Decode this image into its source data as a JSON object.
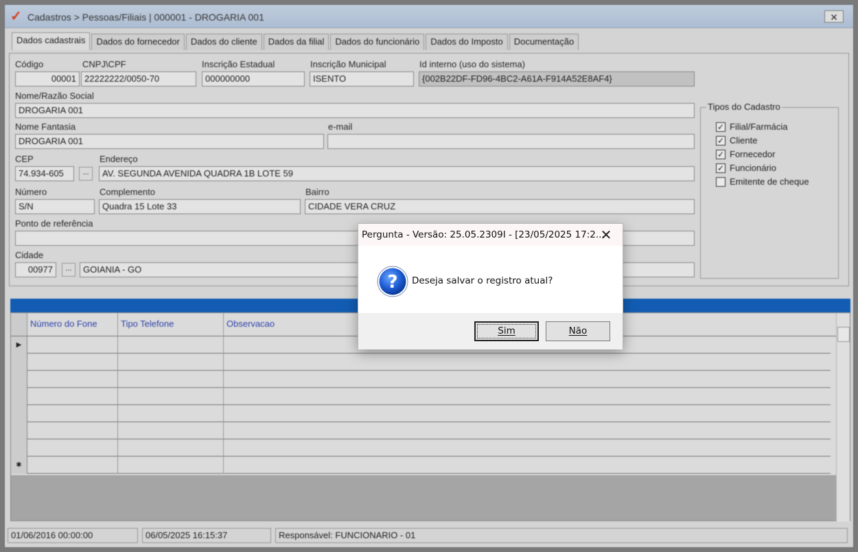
{
  "window": {
    "title": "Cadastros > Pessoas/Filiais | 000001 - DROGARIA 001",
    "close_glyph": "🗙"
  },
  "tabs": [
    {
      "label": "Dados cadastrais"
    },
    {
      "label": "Dados do fornecedor"
    },
    {
      "label": "Dados do cliente"
    },
    {
      "label": "Dados da filial"
    },
    {
      "label": "Dados do funcionário"
    },
    {
      "label": "Dados do Imposto"
    },
    {
      "label": "Documentação"
    }
  ],
  "form": {
    "codigo": {
      "label": "Código",
      "value": "00001"
    },
    "cnpj": {
      "label": "CNPJ\\CPF",
      "value": "22222222/0050-70"
    },
    "inscricao_estadual": {
      "label": "Inscrição Estadual",
      "value": "000000000"
    },
    "inscricao_municipal": {
      "label": "Inscrição Municipal",
      "value": "ISENTO"
    },
    "id_interno": {
      "label": "Id interno (uso do sistema)",
      "value": "{002B22DF-FD96-4BC2-A61A-F914A52E8AF4}"
    },
    "nome_razao": {
      "label": "Nome/Razão Social",
      "value": "DROGARIA 001"
    },
    "nome_fantasia": {
      "label": "Nome Fantasia",
      "value": "DROGARIA 001"
    },
    "email": {
      "label": "e-mail",
      "value": ""
    },
    "cep": {
      "label": "CEP",
      "value": "74.934-605"
    },
    "endereco": {
      "label": "Endereço",
      "value": "AV. SEGUNDA AVENIDA QUADRA 1B  LOTE 59"
    },
    "numero": {
      "label": "Número",
      "value": "S/N"
    },
    "complemento": {
      "label": "Complemento",
      "value": "Quadra 15 Lote 33"
    },
    "bairro": {
      "label": "Bairro",
      "value": "CIDADE VERA CRUZ"
    },
    "ponto_referencia": {
      "label": "Ponto de referência",
      "value": ""
    },
    "cidade": {
      "label": "Cidade",
      "code": "00977",
      "name": "GOIANIA - GO"
    },
    "lookup_label": "..."
  },
  "tipos_cadastro": {
    "title": "Tipos do Cadastro",
    "items": [
      {
        "label": "Filial/Farmácia",
        "checked": true
      },
      {
        "label": "Cliente",
        "checked": true
      },
      {
        "label": "Fornecedor",
        "checked": true
      },
      {
        "label": "Funcionário",
        "checked": true
      },
      {
        "label": "Emitente de cheque",
        "checked": false
      }
    ]
  },
  "phones_grid": {
    "columns": [
      "Número do Fone",
      "Tipo Telefone",
      "Observacao"
    ],
    "row_count": 8,
    "current_marker": "▶",
    "new_marker": "✱"
  },
  "status": {
    "created": "01/06/2016 00:00:00",
    "modified": "06/05/2025 16:15:37",
    "responsavel": "Responsável: FUNCIONARIO - 01"
  },
  "dialog": {
    "title": "Pergunta - Versão: 25.05.2309I - [23/05/2025 17:2...",
    "message": "Deseja salvar o registro atual?",
    "yes_label": "Sim",
    "no_label": "Não",
    "close_glyph": "✕",
    "icon": "question-icon"
  },
  "colors": {
    "grid_header": "#0a5bb8",
    "app_icon": "#e23a12",
    "column_header_text": "#2a3fb0"
  }
}
